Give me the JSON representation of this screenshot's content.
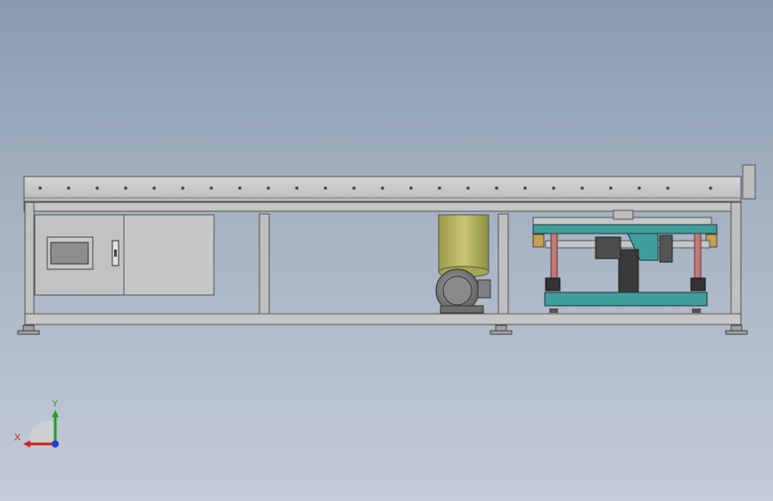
{
  "viewport": {
    "background_top": "#8a9bb0",
    "background_bottom": "#c3ccd7"
  },
  "triad": {
    "x_label": "X",
    "y_label": "Y",
    "x_color": "#d02020",
    "y_color": "#20a020",
    "z_color": "#2040d0"
  },
  "colors": {
    "frame": "#c8c8c8",
    "frame_dark": "#8c8c8c",
    "cabinet": "#bfbfbf",
    "tank": "#b3b35e",
    "fixture_plate": "#3f9e9a",
    "rod": "#c07a7a",
    "brass": "#c8a050"
  }
}
